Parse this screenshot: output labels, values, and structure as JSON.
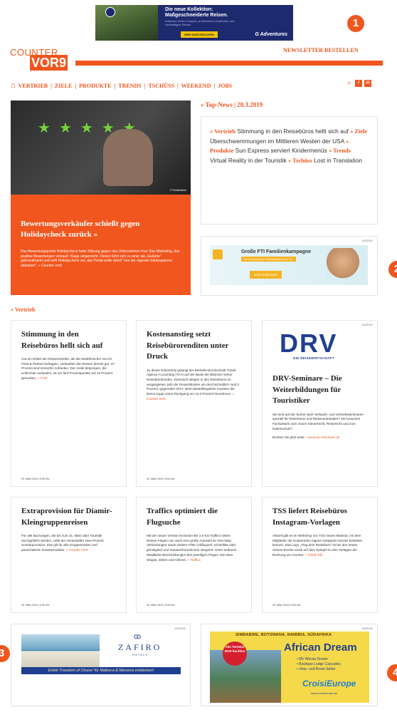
{
  "top_banner": {
    "title": "Die neue Kollektion: Maßgeschneiderte Reisen.",
    "subtitle": "Entdecke kleine Gruppen, authentische Erlebnisse und nachhaltiges Reisen.",
    "button": "WEB DURCHSUCHEN",
    "brand": "G Adventures"
  },
  "markers": [
    "1",
    "2",
    "3",
    "4"
  ],
  "logo": {
    "line1": "COUNTER",
    "line2": "VOR9"
  },
  "newsletter": "NEWSLETTER BESTELLEN",
  "nav": [
    "VERTRIEB",
    "ZIELE",
    "PRODUKTE",
    "TRENDS",
    "TSCHÜSS",
    "WEEKEND",
    "JOBS"
  ],
  "nav_separator": "|",
  "hero": {
    "credit": "© Shutterstock",
    "title": "Bewertungsverkäufer schießt gegen Holidaycheck zurück »",
    "desc": "Das Bewertungsportal Holidaycheck hatte Klärung gegen das Unternehmen Five Star Marketing, das positive Bewertungen verkauft. Klage eingereicht. Dieses führt sich zu einer als „Gekürte“ gebrandmarkt und wirft Holidaycheck vor, das Portal wolle damit \"von der eigenen Intransparenz ablenken\". » Counter vor9"
  },
  "top_news": {
    "heading": "» Top-News | 20.3.2019",
    "items": [
      {
        "key": "» Vertrieb",
        "text": " Stimmung in den Reisebüros hellt sich auf "
      },
      {
        "key": "» Ziele",
        "text": " Überschwemmungen im Mittleren Westen der USA "
      },
      {
        "key": "» Produkte",
        "text": " Sun Express serviert Kindermenüs "
      },
      {
        "key": "» Trends",
        "text": " Virtual Reality in der Touristik "
      },
      {
        "key": "» Tschüss",
        "text": " Lost in Translation"
      }
    ]
  },
  "ad2": {
    "label": "ANZEIGE",
    "title": "Große FTI Familienkampagne",
    "subtitle": "mit kostenlosem Werbematerial für Sie",
    "button": "Jetzt entdecken!"
  },
  "section_heading": "» Vertrieb",
  "cards": [
    {
      "title": "Stimmung in den Reisebüros hellt sich auf",
      "text": "Gut ein Drittel der Reisevertriebe, die die Marktforscher von Dr. Fried & Partner befragten, verkauften den Reisen derzeit gut. 47 Prozent sind immerhin zufrieden. Der Anteil derjenigen, die schlechter verkaufen, ist um fünf Prozentpunkte auf 19 Prozent gesunken.",
      "more": " » TVW",
      "date": "20. März 2019 | 9:00 Uhr"
    },
    {
      "title": "Kostenanstieg setzt Reisebürorenditen unter Druck",
      "text": "Zu dieser Erkenntnis gelangt der Betriebs-Durchschnitt Travel Agency Accounting (TAA) auf der Basis der Bilanzen seiner Reisebürokunden. Demnach stiegen in den Reisebüros im vergangenen Jahr die Gesamtkosten um durchschnittlich rund 2 Prozent, gegenüber 2017. Beim Bestellergebnis mussten die Büros sogar einen Rückgang um 12,3 Prozent hinnehmen.",
      "more": " » Counter vor9",
      "date": "20. März 2019 | 9:00 Uhr"
    },
    {
      "ad_label": "ANZEIGE",
      "logo": "DRV",
      "logo_sub": "DIE REISEWIRTSCHAFT",
      "title": "DRV-Seminare – Die Weiterbildungen für Touristiker",
      "text": "Sie sind auf der Suche nach Verkaufs- und Vertriebsseminaren speziell für Reisebüros und Reiseveranstalter? Sie brauchen Fachwissen zum neuen Steuerrecht, Reiserecht und zum Datenschutz?",
      "text2": "Buchen Sie jetzt unter",
      "more": " » www.drv-seminare.de"
    },
    {
      "title": "Extraprovision für Diamir-Kleingruppenreisen",
      "text": "Für alle Buchungen, die bis zum 31. März über Touristik durchgeführt werden, zahlt der Veranstalter zwei Prozent Sonderprovision. Das gilt für alle Gruppenreisen und pauschalierte Zusatzprodukte.",
      "more": " » Counter vor9",
      "date": "20. März 2019 | 9:00 Uhr"
    },
    {
      "title": "Traffics optimiert die Flugsuche",
      "text": "Mit der neuen Version Evolution-BE 3.6 hat Traffics neben Reisen-Flügen nun auch eine große Auswahl an One-Way-Verbindungen sowie weitere Filter (Abflugzeit, schnellste oder günstigste) und Zusatzinformationen integriert. Unter anderem detaillierte Beschreibungen des jeweiligen Fluges, wie etwa Stopps, Zeiten und Airlines.",
      "more": " » Traffics",
      "date": "20. März 2019 | 9:00 Uhr"
    },
    {
      "title": "TSS liefert Reisebüros Instagram-Vorlagen",
      "text": "Aktuell gibt es im Webshop von TSS neues Material, mit dem Mitglieder der Kooperation eigene Instagram-Stories beliebten können. Das Logo „Trag dein Reisebüro“ ist bei den ersten Stories bereits vorab auf dem Spiegel zu den Vorlagen der Buchung am Counter.",
      "more": " » Friedl Tolli",
      "date": "20. März 2019 | 9:00 Uhr"
    }
  ],
  "ad3": {
    "label": "ANZEIGE",
    "brand": "ZAFIRO",
    "brand_sub": "HOTELS",
    "strip": "Erlebt 'Freedom of Choice' für Mallorca & Menorca entdecken!"
  },
  "ad4": {
    "label": "ANZEIGE",
    "topline": "SIMBABWE, BOTSWANA, NAMIBIA, SÜDAFRIKA",
    "badge": "Alle Termine 2019 buchbar",
    "title": "African Dream",
    "bullets": [
      "• MV African Dream",
      "• Boutique Lodge Cascades",
      "• Jeep- und Boots-Safari"
    ],
    "brand": "CroisiEurope",
    "url": "www.croisieurope.de"
  },
  "colors": {
    "accent": "#f0561e",
    "drv_blue": "#1f3f91"
  },
  "icons": [
    "home-icon",
    "search-icon",
    "facebook-icon",
    "mail-icon"
  ]
}
